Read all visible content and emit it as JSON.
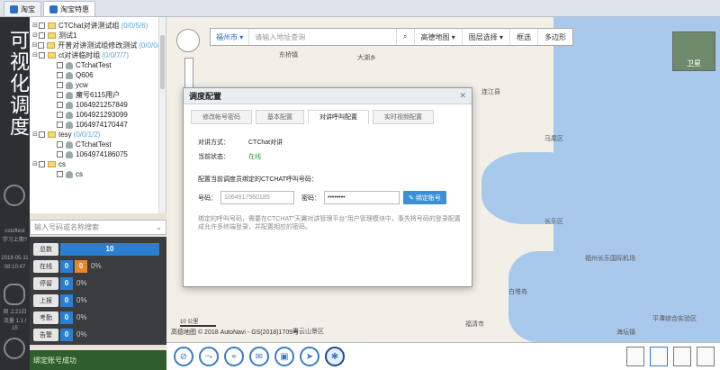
{
  "tabs": [
    "淘宝",
    "淘宝特惠"
  ],
  "rail": {
    "title": "可视化调度",
    "small1": "cstoftest",
    "small2": "学习上期?",
    "small3": "2018-05-11",
    "small4": "08:10:47",
    "small5": "周 上21日",
    "small6": "流量 1.1 / 15"
  },
  "tree": {
    "items": [
      {
        "label": "CTChat对讲测试组",
        "count": "(0/0/5/6)",
        "level": 1,
        "kind": "group"
      },
      {
        "label": "测试1",
        "count": "",
        "level": 1,
        "kind": "group"
      },
      {
        "label": "开普对讲测试组修改测试",
        "count": "(0/0/0/0)",
        "level": 1,
        "kind": "group"
      },
      {
        "label": "ct对讲临时组",
        "count": "(0/0/7/7)",
        "level": 1,
        "kind": "group"
      },
      {
        "label": "CTchatTest",
        "count": "",
        "level": 2,
        "kind": "user"
      },
      {
        "label": "Q606",
        "count": "",
        "level": 2,
        "kind": "user"
      },
      {
        "label": "ycw",
        "count": "",
        "level": 2,
        "kind": "user"
      },
      {
        "label": "魔号6115用户",
        "count": "",
        "level": 2,
        "kind": "user"
      },
      {
        "label": "1064921257849",
        "count": "",
        "level": 2,
        "kind": "user"
      },
      {
        "label": "1064921293099",
        "count": "",
        "level": 2,
        "kind": "user"
      },
      {
        "label": "1064974170447",
        "count": "",
        "level": 2,
        "kind": "user"
      },
      {
        "label": "tesy",
        "count": "(0/0/1/2)",
        "level": 1,
        "kind": "group"
      },
      {
        "label": "CTchatTest",
        "count": "",
        "level": 2,
        "kind": "user"
      },
      {
        "label": "1064974186075",
        "count": "",
        "level": 2,
        "kind": "user"
      },
      {
        "label": "cs",
        "count": "",
        "level": 1,
        "kind": "group"
      },
      {
        "label": "cs",
        "count": "",
        "level": 2,
        "kind": "user"
      }
    ]
  },
  "search": {
    "placeholder": "输入号码或名称搜索"
  },
  "stats": [
    {
      "label": "总数",
      "a": "10",
      "b": "",
      "pct": "",
      "color_a": "#2b7fd0"
    },
    {
      "label": "在线",
      "a": "0",
      "b": "0",
      "pct": "0%",
      "color_a": "#2b7fd0",
      "color_b": "#e6882a"
    },
    {
      "label": "停留",
      "a": "0",
      "b": "",
      "pct": "0%",
      "color_a": "#2b7fd0"
    },
    {
      "label": "上报",
      "a": "0",
      "b": "",
      "pct": "0%",
      "color_a": "#2b7fd0"
    },
    {
      "label": "考勤",
      "a": "0",
      "b": "",
      "pct": "0%",
      "color_a": "#2b7fd0"
    },
    {
      "label": "告警",
      "a": "0",
      "b": "",
      "pct": "0%",
      "color_a": "#2b7fd0"
    }
  ],
  "status": {
    "text": "绑定账号成功"
  },
  "map_toolbar": {
    "city": "福州市 ▾",
    "address_placeholder": "请输入地址查询",
    "map_type": "高德地图 ▾",
    "layer": "图层选择 ▾",
    "select": "框选",
    "polygon": "多边形"
  },
  "map": {
    "satellite": "卫星",
    "scale": "10 公里",
    "footer": "高德地图 © 2018 AutoNavi - GS(2018)1709号",
    "labels": [
      "东桥镇",
      "大湖乡",
      "连江县",
      "长乐区",
      "福州长乐国际机场",
      "福清市",
      "青云山景区",
      "平潭综合实验区",
      "海坛镇",
      "白塔岛",
      "马尾区"
    ]
  },
  "dialog": {
    "title": "调度配置",
    "close": "✕",
    "tabs": [
      "修改帐号密码",
      "基本配置",
      "对讲呼叫配置",
      "实时视频配置"
    ],
    "active_tab": 2,
    "mode_label": "对讲方式：",
    "mode_value": "CTChat对讲",
    "state_label": "当前状态：",
    "state_value": "在线",
    "bind_title": "配置当前调度员绑定的CTCHAT呼叫号码：",
    "number_label": "号码：",
    "number_placeholder": "1064917560185",
    "password_label": "密码：",
    "password_value": "••••••••",
    "bind_button": "绑定账号",
    "note": "绑定的呼叫号码，需要在CTCHAT\"天翼对讲管理平台\"用户管理模块中，事先将号码的登录配置成允许多终端登录，并配置相应的密码。"
  },
  "colors": {
    "accent": "#3a8fd6",
    "online": "#2e9a42",
    "status_bar": "#2f5e2c"
  }
}
